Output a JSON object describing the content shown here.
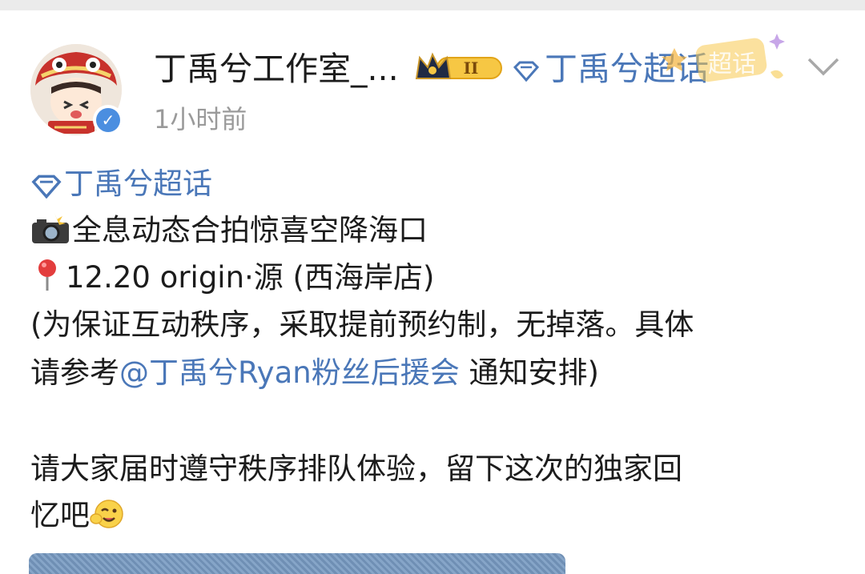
{
  "header": {
    "username": "丁禹兮工作室_...",
    "badge_level": "II",
    "topic_link": "丁禹兮超话",
    "sticker_text": "超话",
    "timestamp": "1小时前"
  },
  "post": {
    "topic_tag": "丁禹兮超话",
    "line1": "全息动态合拍惊喜空降海口",
    "line2": "12.20 origin·源 (西海岸店)",
    "line3": "(为保证互动秩序，采取提前预约制，无掉落。具体",
    "line4_prefix": "请参考",
    "mention": "@丁禹兮Ryan粉丝后援会",
    "line4_suffix": " 通知安排)",
    "line5": "请大家届时遵守秩序排队体验，留下这次的独家回",
    "line6": "忆吧"
  },
  "colors": {
    "link_blue": "#4a77b8",
    "timestamp_gray": "#9a9a9a",
    "verified_blue": "#4b8ee0"
  }
}
